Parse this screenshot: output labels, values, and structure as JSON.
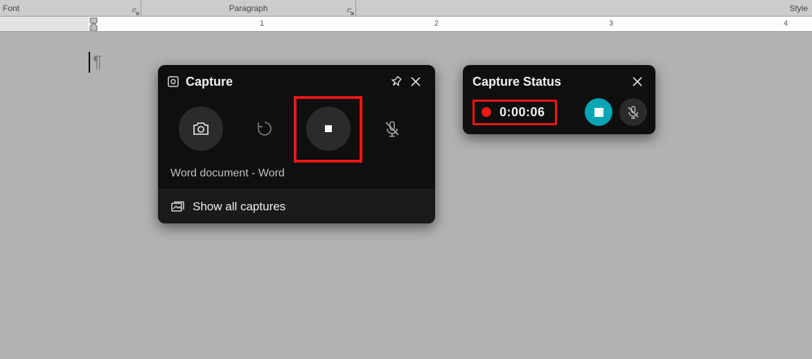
{
  "ribbon": {
    "group_font": "Font",
    "group_paragraph": "Paragraph",
    "group_style": "Style"
  },
  "ruler": {
    "numbers": [
      "1",
      "2",
      "3",
      "4"
    ]
  },
  "document": {
    "paragraph_mark": "¶"
  },
  "capture": {
    "title": "Capture",
    "target": "Word document - Word",
    "show_all": "Show all captures",
    "icons": {
      "screenshot": "camera-icon",
      "last30": "rewind-icon",
      "stop": "stop-icon",
      "mic": "mic-muted-icon"
    }
  },
  "status": {
    "title": "Capture Status",
    "elapsed": "0:00:06"
  }
}
